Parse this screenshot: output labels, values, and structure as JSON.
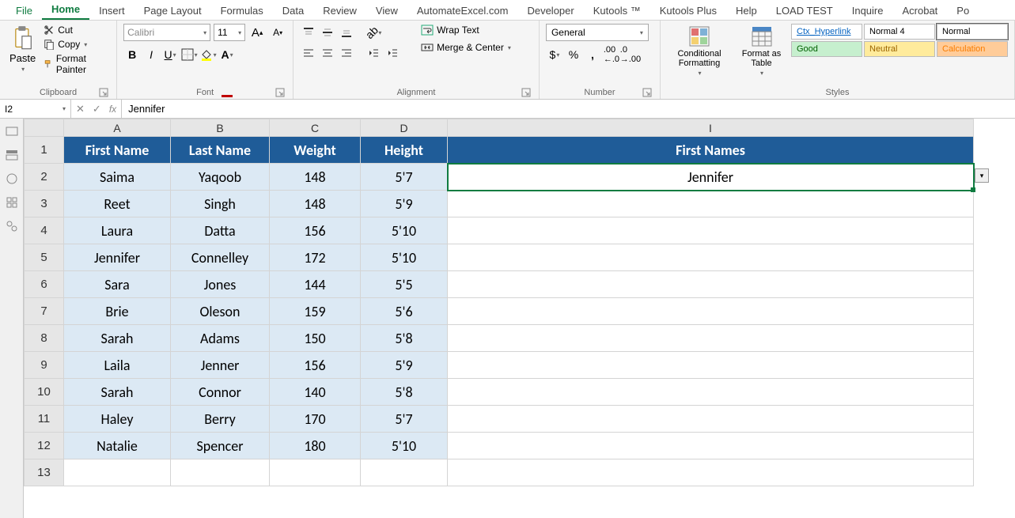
{
  "tabs": [
    "File",
    "Home",
    "Insert",
    "Page Layout",
    "Formulas",
    "Data",
    "Review",
    "View",
    "AutomateExcel.com",
    "Developer",
    "Kutools ™",
    "Kutools Plus",
    "Help",
    "LOAD TEST",
    "Inquire",
    "Acrobat",
    "Po"
  ],
  "active_tab": "Home",
  "clipboard": {
    "paste": "Paste",
    "cut": "Cut",
    "copy": "Copy",
    "format_painter": "Format Painter",
    "group_label": "Clipboard"
  },
  "font": {
    "name": "Calibri",
    "size": "11",
    "group_label": "Font"
  },
  "alignment": {
    "wrap": "Wrap Text",
    "merge": "Merge & Center",
    "group_label": "Alignment"
  },
  "number": {
    "format": "General",
    "group_label": "Number"
  },
  "styles": {
    "cond": "Conditional Formatting",
    "fat": "Format as Table",
    "group_label": "Styles",
    "gallery": [
      {
        "t": "Ctx_Hyperlink",
        "bg": "#ffffff",
        "col": "#0563c1",
        "u": true
      },
      {
        "t": "Normal 4",
        "bg": "#ffffff",
        "col": "#000"
      },
      {
        "t": "Normal",
        "bg": "#ffffff",
        "col": "#000",
        "sel": true
      },
      {
        "t": "Good",
        "bg": "#c6efce",
        "col": "#006100"
      },
      {
        "t": "Neutral",
        "bg": "#ffeb9c",
        "col": "#9c6500"
      },
      {
        "t": "Calculation",
        "bg": "#ffcc99",
        "col": "#fa7d00"
      }
    ]
  },
  "name_box": "I2",
  "formula": "Jennifer",
  "columns": [
    "A",
    "B",
    "C",
    "D",
    "I"
  ],
  "headers": {
    "A": "First Name",
    "B": "Last Name",
    "C": "Weight",
    "D": "Height",
    "I": "First Names"
  },
  "rows": [
    {
      "r": 2,
      "a": "Saima",
      "b": "Yaqoob",
      "c": "148",
      "d": "5'7",
      "i": "Jennifer"
    },
    {
      "r": 3,
      "a": "Reet",
      "b": "Singh",
      "c": "148",
      "d": "5'9",
      "i": ""
    },
    {
      "r": 4,
      "a": "Laura",
      "b": "Datta",
      "c": "156",
      "d": "5'10",
      "i": ""
    },
    {
      "r": 5,
      "a": "Jennifer",
      "b": "Connelley",
      "c": "172",
      "d": "5'10",
      "i": ""
    },
    {
      "r": 6,
      "a": "Sara",
      "b": "Jones",
      "c": "144",
      "d": "5'5",
      "i": ""
    },
    {
      "r": 7,
      "a": "Brie",
      "b": "Oleson",
      "c": "159",
      "d": "5'6",
      "i": ""
    },
    {
      "r": 8,
      "a": "Sarah",
      "b": "Adams",
      "c": "150",
      "d": "5'8",
      "i": ""
    },
    {
      "r": 9,
      "a": "Laila",
      "b": "Jenner",
      "c": "156",
      "d": "5'9",
      "i": ""
    },
    {
      "r": 10,
      "a": "Sarah",
      "b": "Connor",
      "c": "140",
      "d": "5'8",
      "i": ""
    },
    {
      "r": 11,
      "a": "Haley",
      "b": "Berry",
      "c": "170",
      "d": "5'7",
      "i": ""
    },
    {
      "r": 12,
      "a": "Natalie",
      "b": "Spencer",
      "c": "180",
      "d": "5'10",
      "i": ""
    },
    {
      "r": 13,
      "a": "",
      "b": "",
      "c": "",
      "d": "",
      "i": ""
    }
  ],
  "active_cell": "I2"
}
